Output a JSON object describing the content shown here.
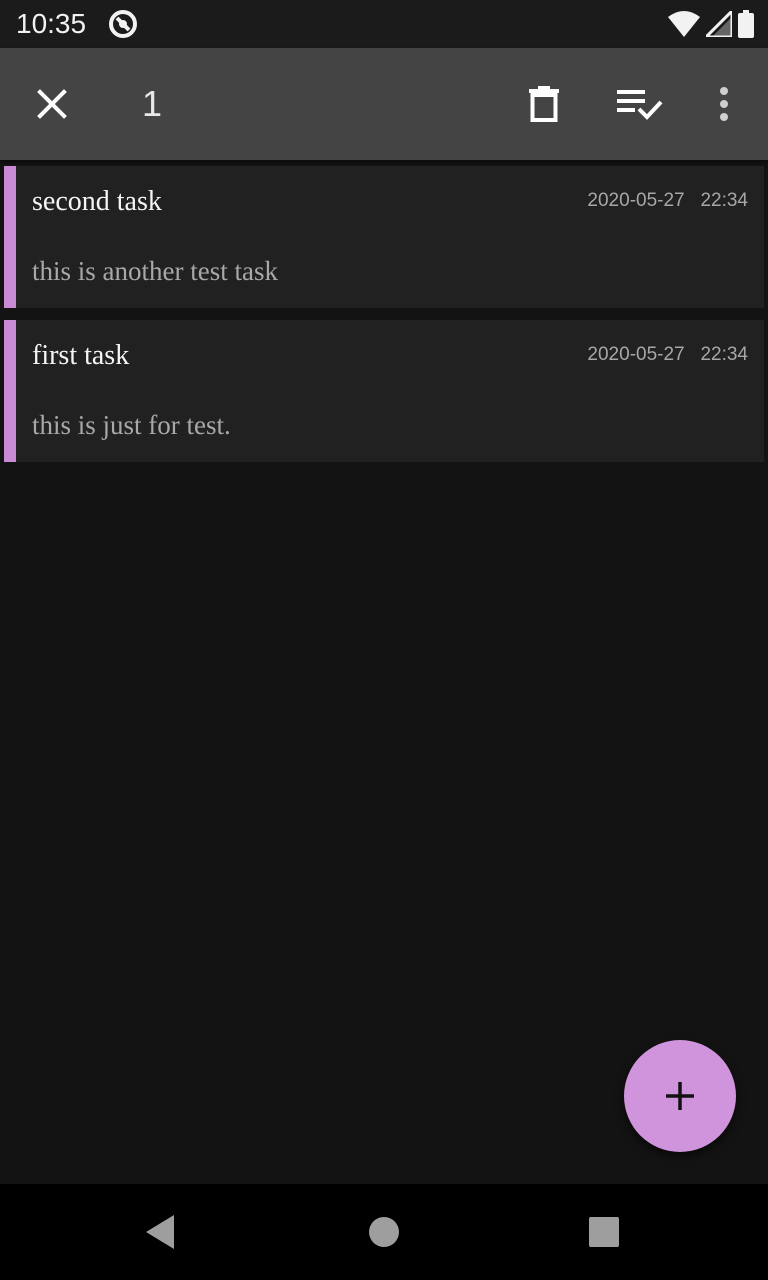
{
  "status_bar": {
    "time": "10:35",
    "icons": [
      "app-notification-icon",
      "wifi-icon",
      "signal-icon",
      "battery-icon"
    ]
  },
  "action_bar": {
    "selected_count": "1",
    "icons": [
      "close-icon",
      "trash-icon",
      "select-all-icon",
      "more-vert-icon"
    ]
  },
  "tasks": [
    {
      "title": "second task",
      "date": "2020-05-27   22:34",
      "description": "this is another test task"
    },
    {
      "title": "first task",
      "date": "2020-05-27   22:34",
      "description": "this is just for test."
    }
  ],
  "fab": {
    "icon": "plus-icon"
  },
  "nav_bar": {
    "icons": [
      "back-icon",
      "home-icon",
      "recents-icon"
    ]
  },
  "colors": {
    "accent": "#c98ad6",
    "fab": "#cf94dc",
    "background": "#131313",
    "card": "#212121",
    "toolbar": "#444444"
  }
}
